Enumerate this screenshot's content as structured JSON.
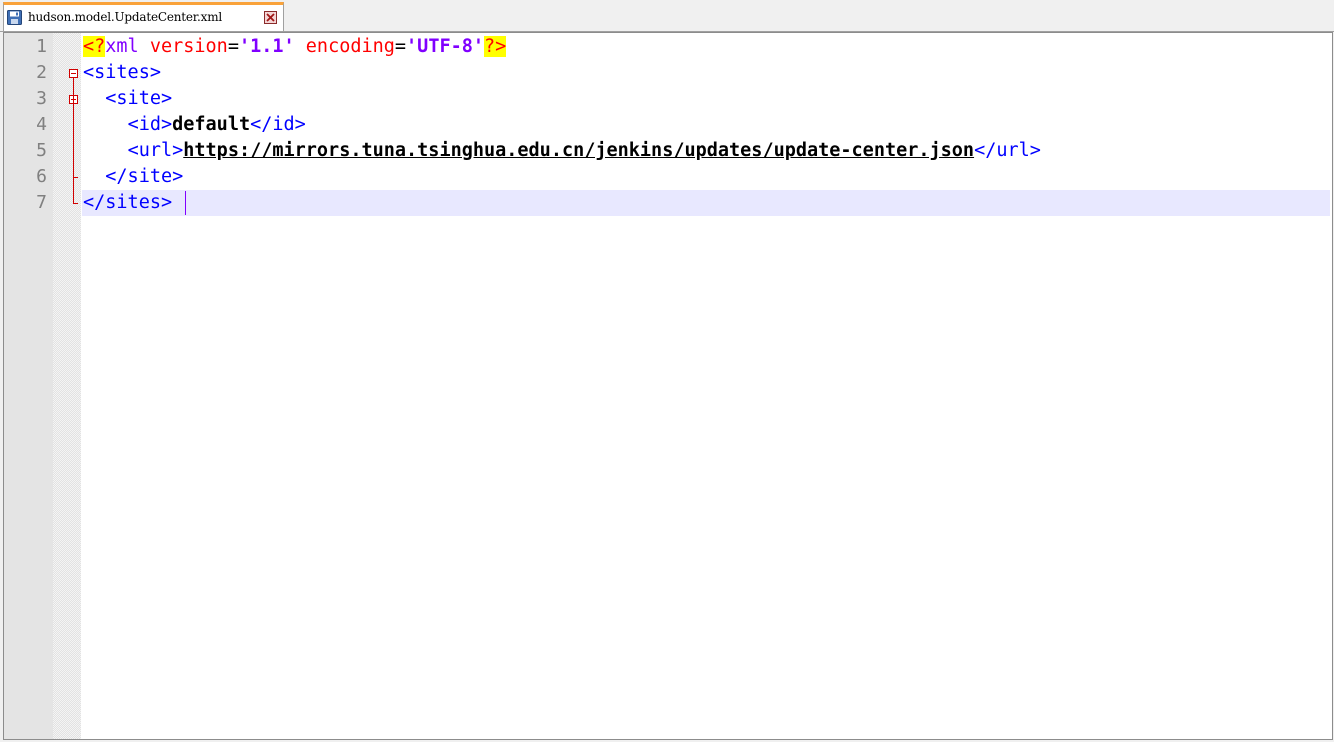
{
  "tab": {
    "filename": "hudson.model.UpdateCenter.xml",
    "icon": "save-icon",
    "close_icon": "close-icon",
    "accent_color": "#f9a23a"
  },
  "editor": {
    "line_numbers": [
      "1",
      "2",
      "3",
      "4",
      "5",
      "6",
      "7"
    ],
    "lines": {
      "l1": {
        "pi_open": "<?",
        "pi_name": "xml",
        "attr1": " version",
        "eq1": "=",
        "val1": "'1.1'",
        "attr2": " encoding",
        "eq2": "=",
        "val2": "'UTF-8'",
        "pi_close": "?>"
      },
      "l2": {
        "tag": "<sites>"
      },
      "l3": {
        "indent": "  ",
        "tag": "<site>"
      },
      "l4": {
        "indent": "    ",
        "open": "<id>",
        "text": "default",
        "close": "</id>"
      },
      "l5": {
        "indent": "    ",
        "open": "<url>",
        "text": "https://mirrors.tuna.tsinghua.edu.cn/jenkins/updates/update-center.json",
        "close": "</url>"
      },
      "l6": {
        "indent": "  ",
        "tag": "</site>"
      },
      "l7": {
        "tag": "</sites>"
      }
    },
    "current_line": "7",
    "colors": {
      "tag": "#0000ff",
      "attribute": "#ff0000",
      "attribute_value": "#8000ff",
      "processing_instruction_bg": "#ffff00",
      "current_line_bg": "#e8e8ff",
      "fold_marker": "#d00000"
    }
  }
}
